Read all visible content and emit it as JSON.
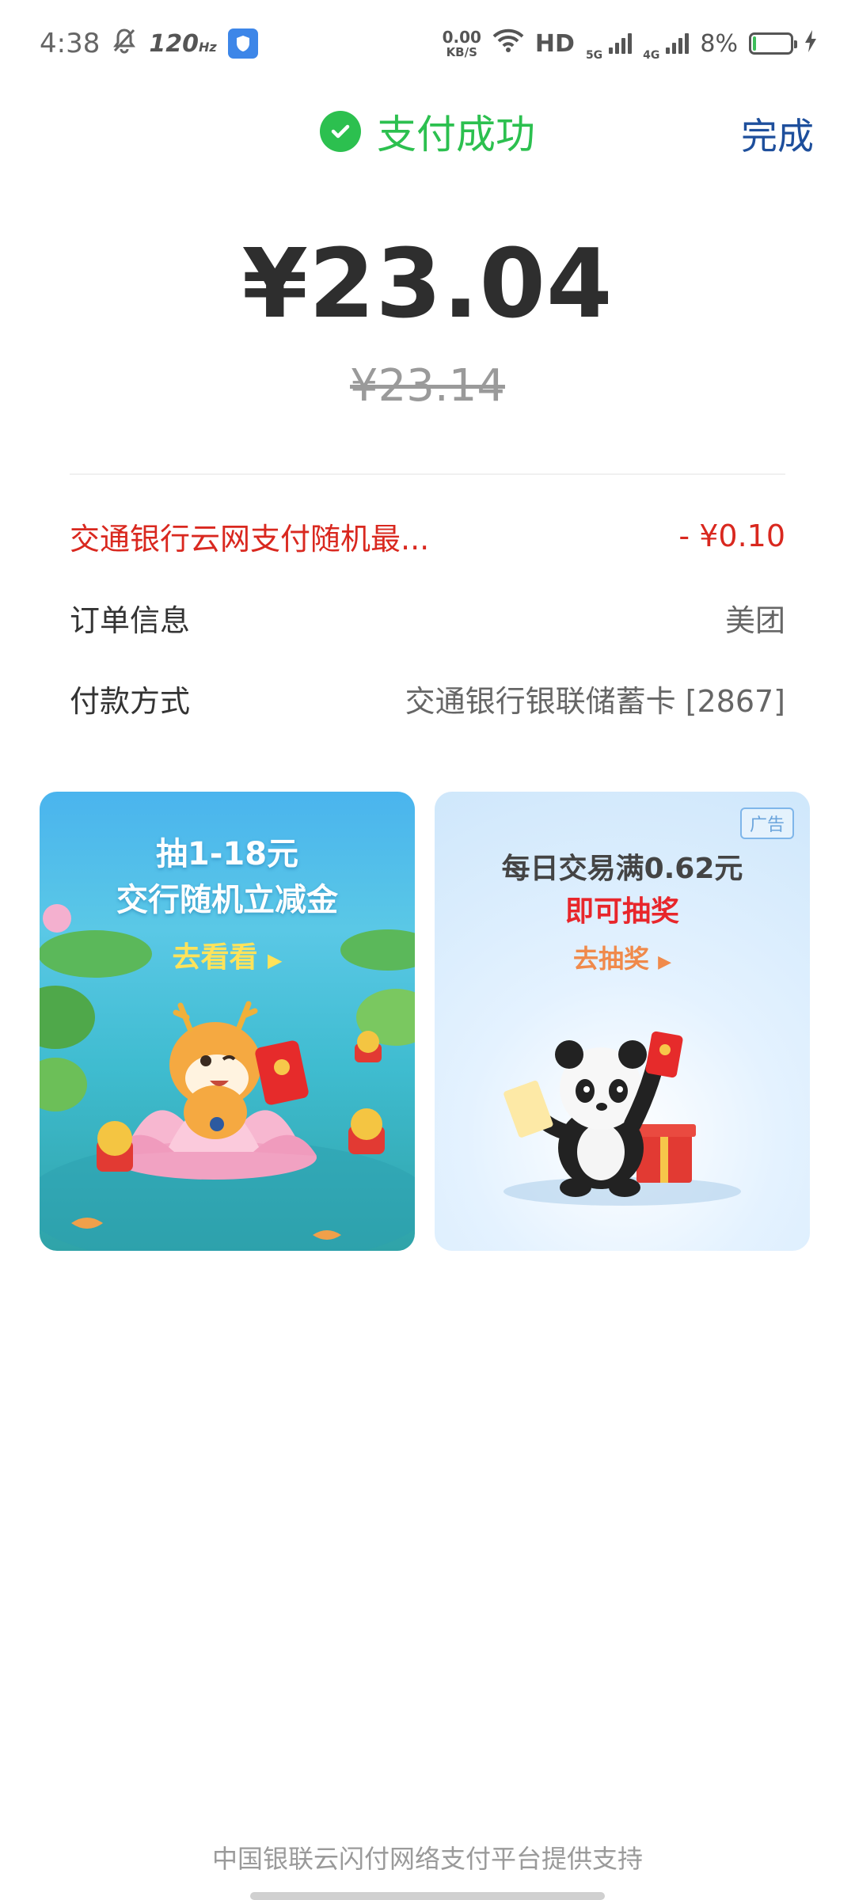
{
  "status_bar": {
    "time": "4:38",
    "refresh_rate": "120",
    "refresh_unit": "Hz",
    "net_speed": "0.00",
    "net_unit": "KB/S",
    "hd_label": "HD",
    "sig1_label": "5G",
    "sig2_label": "4G",
    "battery_pct": "8%",
    "battery_level": 0.08
  },
  "header": {
    "title": "支付成功",
    "done_label": "完成"
  },
  "payment": {
    "amount": "¥23.04",
    "original_amount": "¥23.14"
  },
  "details": {
    "discount": {
      "label": "交通银行云网支付随机最...",
      "value": "- ¥0.10"
    },
    "order": {
      "label": "订单信息",
      "value": "美团"
    },
    "method": {
      "label": "付款方式",
      "value": "交通银行银联储蓄卡 [2867]"
    }
  },
  "banners": {
    "left": {
      "line1": "抽1-18元",
      "line2": "交行随机立减金",
      "cta": "去看看"
    },
    "right": {
      "ad_tag": "广告",
      "line1": "每日交易满0.62元",
      "line2": "即可抽奖",
      "cta": "去抽奖"
    }
  },
  "footer": {
    "text": "中国银联云闪付网络支付平台提供支持"
  },
  "colors": {
    "success": "#2cc04f",
    "link": "#1e4f9c",
    "discount": "#d9281f"
  }
}
